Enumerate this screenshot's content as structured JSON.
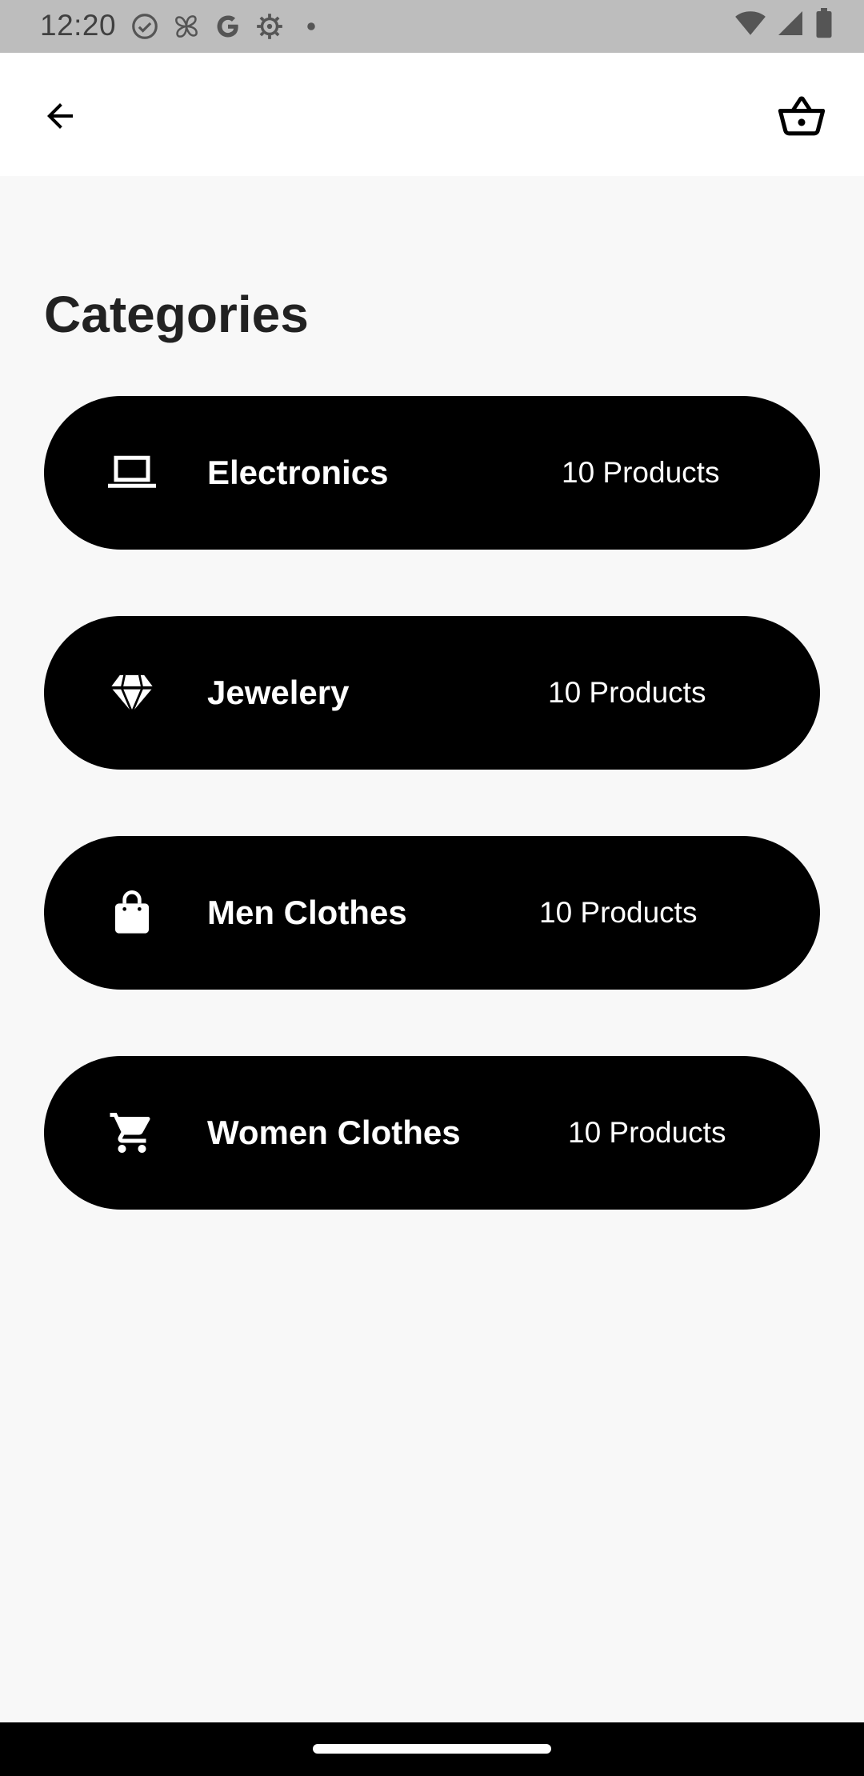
{
  "status_bar": {
    "time": "12:20",
    "icons_left": [
      "check-circle-icon",
      "fan-icon",
      "google-icon",
      "settings-gear-icon",
      "dot-icon"
    ],
    "icons_right": [
      "wifi-icon",
      "cell-signal-icon",
      "battery-icon"
    ]
  },
  "app_bar": {
    "back_icon": "arrow-back-icon",
    "cart_icon": "shopping-basket-icon"
  },
  "page": {
    "title": "Categories"
  },
  "categories": [
    {
      "name": "Electronics",
      "count": "10 Products",
      "icon": "laptop-icon"
    },
    {
      "name": "Jewelery",
      "count": "10 Products",
      "icon": "diamond-icon"
    },
    {
      "name": "Men Clothes",
      "count": "10 Products",
      "icon": "shopping-bag-icon"
    },
    {
      "name": "Women Clothes",
      "count": "10 Products",
      "icon": "shopping-cart-icon"
    }
  ],
  "colors": {
    "background": "#f8f8f8",
    "card": "#000000",
    "card_text": "#ffffff",
    "title": "#222222",
    "status_bar": "#bdbdbd"
  }
}
